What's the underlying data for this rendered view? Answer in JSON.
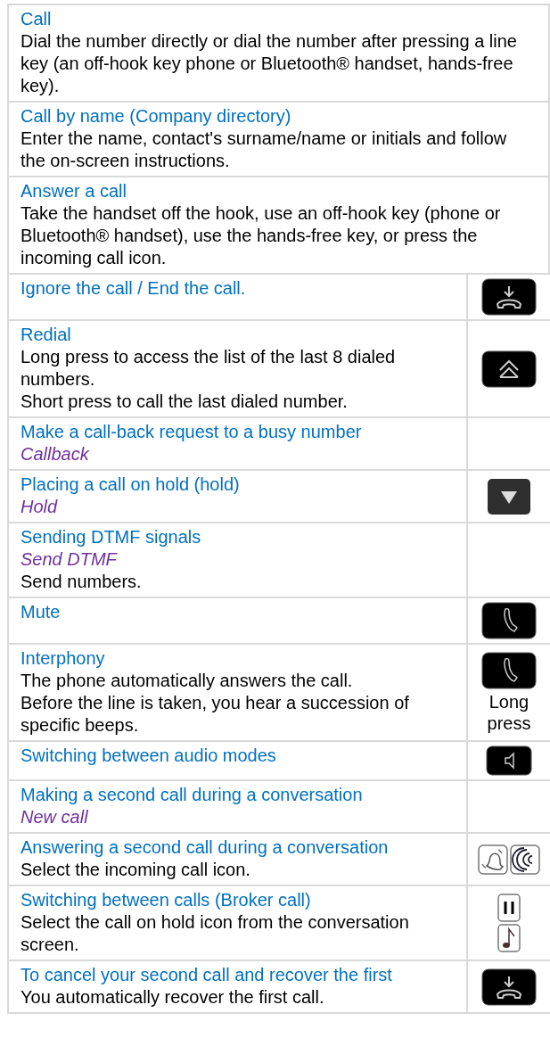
{
  "rows": [
    {
      "kind": "wide",
      "title": "Call",
      "lines": [
        {
          "kind": "text",
          "text": "Dial the number directly or dial the number after pressing a line key (an off-hook key phone or Bluetooth® handset, hands-free key)."
        }
      ]
    },
    {
      "kind": "wide",
      "title": "Call by name (Company directory)",
      "lines": [
        {
          "kind": "text",
          "text": "Enter the name, contact's surname/name or initials and follow the on-screen instructions."
        }
      ]
    },
    {
      "kind": "wide",
      "title": "Answer a call",
      "lines": [
        {
          "kind": "text",
          "text": "Take the handset off the hook, use an off-hook key (phone or Bluetooth® handset), use the hands-free key, or press the incoming call icon."
        }
      ]
    },
    {
      "kind": "split",
      "title": "Ignore the call / End the call.",
      "lines": [],
      "icons": [
        {
          "kind": "hangup"
        }
      ]
    },
    {
      "kind": "split",
      "title": "Redial",
      "lines": [
        {
          "kind": "text",
          "text": "Long press to access the list of the last 8 dialed numbers."
        },
        {
          "kind": "text",
          "text": "Short press to call the last dialed number."
        }
      ],
      "icons": [
        {
          "kind": "redial"
        }
      ]
    },
    {
      "kind": "split",
      "title": "Make a call-back request to a busy number",
      "lines": [
        {
          "kind": "softkey",
          "text": "Callback"
        }
      ],
      "icons": []
    },
    {
      "kind": "split",
      "title": "Placing a call on hold (hold)",
      "lines": [
        {
          "kind": "softkey",
          "text": "Hold"
        }
      ],
      "icons": [
        {
          "kind": "hold"
        }
      ]
    },
    {
      "kind": "split",
      "title": "Sending DTMF signals",
      "lines": [
        {
          "kind": "softkey",
          "text": "Send DTMF"
        },
        {
          "kind": "text",
          "text": "Send numbers."
        }
      ],
      "icons": []
    },
    {
      "kind": "split",
      "title": "Mute",
      "lines": [],
      "icons": [
        {
          "kind": "mute"
        }
      ]
    },
    {
      "kind": "split",
      "title": "Interphony",
      "lines": [
        {
          "kind": "text",
          "text": "The phone automatically answers the call."
        },
        {
          "kind": "text",
          "text": "Before the line is taken, you hear a succession of specific beeps."
        }
      ],
      "icons": [
        {
          "kind": "mute"
        }
      ],
      "note": "Long press"
    },
    {
      "kind": "split",
      "title": "Switching between audio modes",
      "lines": [],
      "icons": [
        {
          "kind": "audio"
        }
      ]
    },
    {
      "kind": "split",
      "title": "Making a second call during a conversation",
      "lines": [
        {
          "kind": "softkey",
          "text": "New call"
        }
      ],
      "icons": []
    },
    {
      "kind": "split",
      "title": "Answering a second call during a conversation",
      "lines": [
        {
          "kind": "text",
          "text": "Select the incoming call icon."
        }
      ],
      "icons": [
        {
          "kind": "bell"
        },
        {
          "kind": "waves"
        }
      ]
    },
    {
      "kind": "split",
      "title": "Switching between calls (Broker call)",
      "lines": [
        {
          "kind": "text",
          "text": "Select the call on hold icon from the conversation screen."
        }
      ],
      "icons": [
        {
          "kind": "pause"
        },
        {
          "kind": "music"
        }
      ]
    },
    {
      "kind": "split",
      "title": "To cancel your second call and recover the first",
      "lines": [
        {
          "kind": "text",
          "text": "You automatically recover the first call."
        }
      ],
      "icons": [
        {
          "kind": "hangup"
        }
      ]
    }
  ]
}
